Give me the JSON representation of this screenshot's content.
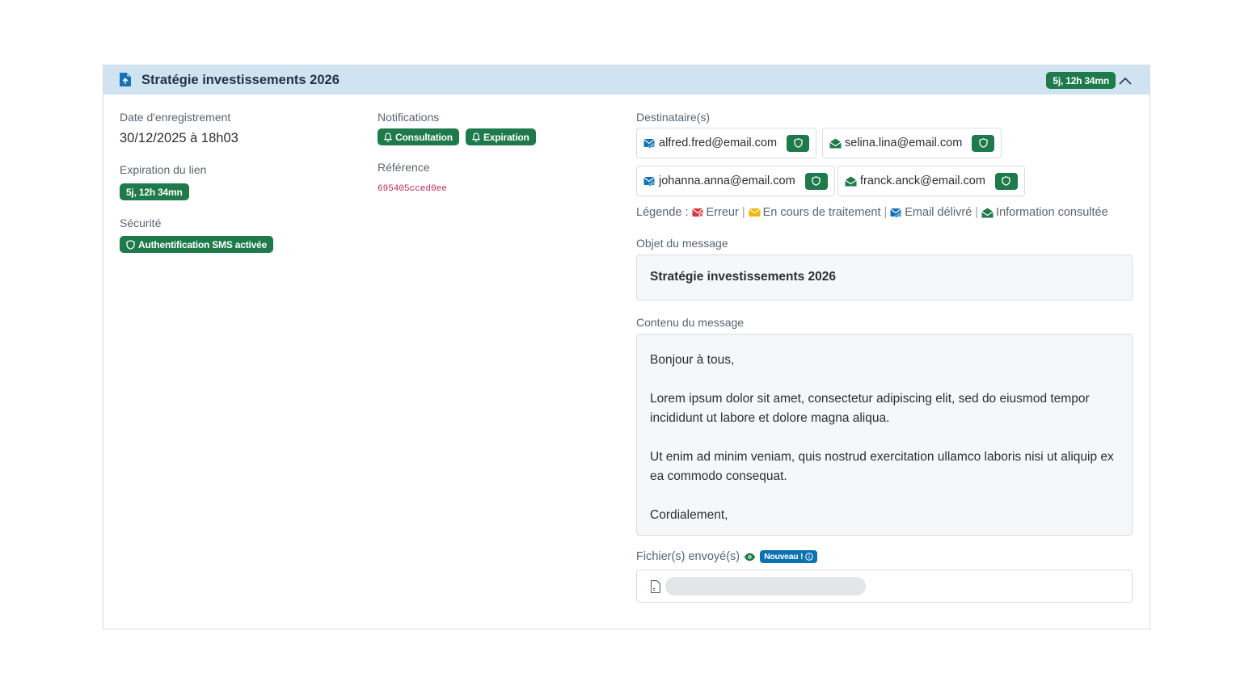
{
  "header": {
    "title": "Stratégie investissements 2026",
    "countdown": "5j, 12h 34mn"
  },
  "left": {
    "date_label": "Date d'enregistrement",
    "date_value": "30/12/2025 à 18h03",
    "expiration_label": "Expiration du lien",
    "expiration_value": "5j, 12h 34mn",
    "security_label": "Sécurité",
    "security_value": "Authentification SMS activée"
  },
  "middle": {
    "notifications_label": "Notifications",
    "notifications": [
      "Consultation",
      "Expiration"
    ],
    "reference_label": "Référence",
    "reference_value": "695405cced0ee"
  },
  "recipients": {
    "label": "Destinataire(s)",
    "items": [
      {
        "email": "alfred.fred@email.com",
        "status": "delivered"
      },
      {
        "email": "selina.lina@email.com",
        "status": "consulted"
      },
      {
        "email": "johanna.anna@email.com",
        "status": "delivered"
      },
      {
        "email": "franck.anck@email.com",
        "status": "consulted"
      }
    ]
  },
  "legend": {
    "prefix": "Légende :",
    "items": [
      "Erreur",
      "En cours de traitement",
      "Email délivré",
      "Information consultée"
    ]
  },
  "subject": {
    "label": "Objet du message",
    "value": "Stratégie investissements 2026"
  },
  "content": {
    "label": "Contenu du message",
    "paragraphs": [
      "Bonjour à tous,",
      "Lorem ipsum dolor sit amet, consectetur adipiscing elit, sed do eiusmod tempor incididunt ut labore et dolore magna aliqua.",
      "Ut enim ad minim veniam, quis nostrud exercitation ullamco laboris nisi ut aliquip ex ea commodo consequat.",
      "Cordialement,"
    ]
  },
  "files": {
    "label": "Fichier(s) envoyé(s)",
    "new_badge": "Nouveau !"
  },
  "colors": {
    "accent_green": "#1e7a4a",
    "header_bg": "#cfe4f0",
    "blue": "#0b73b5",
    "error_red": "#d9363e",
    "processing_yellow": "#f2b705",
    "reference_pink": "#c2255c"
  },
  "icons": {
    "header": "file-upload-icon",
    "collapse": "chevron-up-icon",
    "notification": "bell-icon",
    "security": "shield-icon",
    "delivered": "email-delivered-icon",
    "consulted": "email-open-icon",
    "error": "email-error-icon",
    "processing": "email-processing-icon",
    "preview": "eye-icon",
    "info": "info-icon",
    "file": "file-icon"
  }
}
